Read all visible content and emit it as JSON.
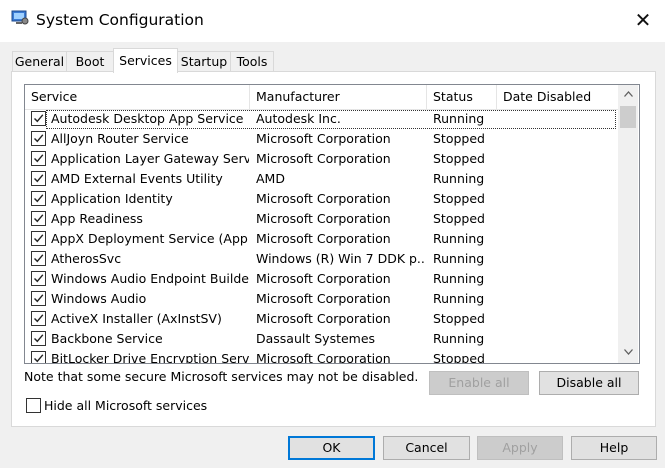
{
  "window": {
    "title": "System Configuration",
    "close_glyph": "✕"
  },
  "tabs": [
    {
      "label": "General"
    },
    {
      "label": "Boot"
    },
    {
      "label": "Services",
      "active": true
    },
    {
      "label": "Startup"
    },
    {
      "label": "Tools"
    }
  ],
  "services_list": {
    "columns": [
      "Service",
      "Manufacturer",
      "Status",
      "Date Disabled"
    ],
    "rows": [
      {
        "checked": true,
        "service": "Autodesk Desktop App Service",
        "manufacturer": "Autodesk Inc.",
        "status": "Running",
        "date_disabled": ""
      },
      {
        "checked": true,
        "service": "AllJoyn Router Service",
        "manufacturer": "Microsoft Corporation",
        "status": "Stopped",
        "date_disabled": ""
      },
      {
        "checked": true,
        "service": "Application Layer Gateway Service",
        "manufacturer": "Microsoft Corporation",
        "status": "Stopped",
        "date_disabled": ""
      },
      {
        "checked": true,
        "service": "AMD External Events Utility",
        "manufacturer": "AMD",
        "status": "Running",
        "date_disabled": ""
      },
      {
        "checked": true,
        "service": "Application Identity",
        "manufacturer": "Microsoft Corporation",
        "status": "Stopped",
        "date_disabled": ""
      },
      {
        "checked": true,
        "service": "App Readiness",
        "manufacturer": "Microsoft Corporation",
        "status": "Stopped",
        "date_disabled": ""
      },
      {
        "checked": true,
        "service": "AppX Deployment Service (App...",
        "manufacturer": "Microsoft Corporation",
        "status": "Running",
        "date_disabled": ""
      },
      {
        "checked": true,
        "service": "AtherosSvc",
        "manufacturer": "Windows (R) Win 7 DDK p...",
        "status": "Running",
        "date_disabled": ""
      },
      {
        "checked": true,
        "service": "Windows Audio Endpoint Builder",
        "manufacturer": "Microsoft Corporation",
        "status": "Running",
        "date_disabled": ""
      },
      {
        "checked": true,
        "service": "Windows Audio",
        "manufacturer": "Microsoft Corporation",
        "status": "Running",
        "date_disabled": ""
      },
      {
        "checked": true,
        "service": "ActiveX Installer (AxInstSV)",
        "manufacturer": "Microsoft Corporation",
        "status": "Stopped",
        "date_disabled": ""
      },
      {
        "checked": true,
        "service": "Backbone Service",
        "manufacturer": "Dassault Systemes",
        "status": "Running",
        "date_disabled": ""
      },
      {
        "checked": true,
        "service": "BitLocker Drive Encryption Service",
        "manufacturer": "Microsoft Corporation",
        "status": "Stopped",
        "date_disabled": ""
      }
    ]
  },
  "note": "Note that some secure Microsoft services may not be disabled.",
  "buttons": {
    "enable_all": {
      "label": "Enable all",
      "enabled": false
    },
    "disable_all": {
      "label": "Disable all",
      "enabled": true
    },
    "ok": "OK",
    "cancel": "Cancel",
    "apply": {
      "label": "Apply",
      "enabled": false
    },
    "help": "Help"
  },
  "hide_ms": {
    "label": "Hide all Microsoft services",
    "checked": false
  },
  "colors": {
    "accent": "#0078d7",
    "window_bg": "#f0f0f0"
  }
}
